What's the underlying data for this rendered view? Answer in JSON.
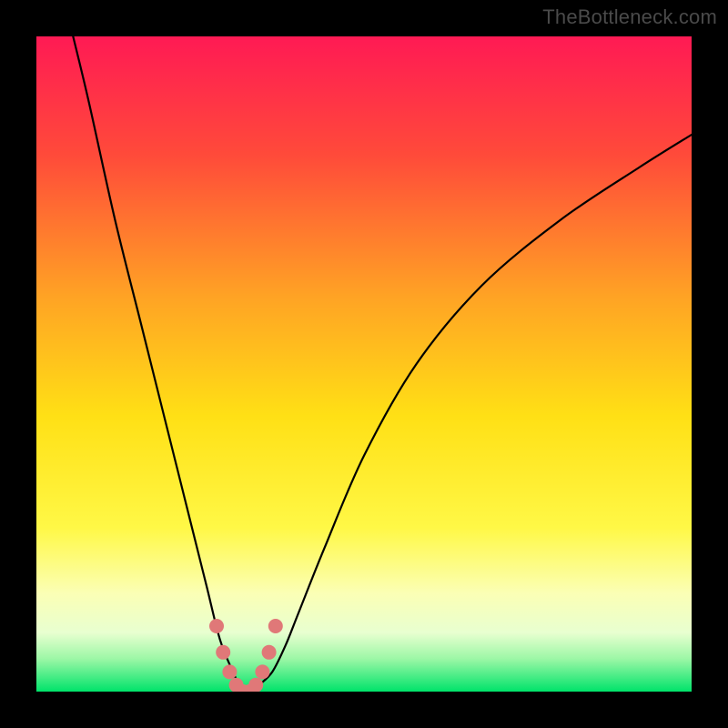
{
  "watermark": {
    "text": "TheBottleneck.com"
  },
  "chart_data": {
    "type": "line",
    "title": "",
    "xlabel": "",
    "ylabel": "",
    "xlim": [
      0,
      100
    ],
    "ylim": [
      0,
      100
    ],
    "background_gradient_stops": [
      {
        "pct": 0,
        "color": "#ff1a54"
      },
      {
        "pct": 18,
        "color": "#ff4a3a"
      },
      {
        "pct": 40,
        "color": "#ffa424"
      },
      {
        "pct": 58,
        "color": "#ffe015"
      },
      {
        "pct": 75,
        "color": "#fff846"
      },
      {
        "pct": 85,
        "color": "#fbffb5"
      },
      {
        "pct": 91,
        "color": "#e8ffd0"
      },
      {
        "pct": 95,
        "color": "#9cf7a6"
      },
      {
        "pct": 100,
        "color": "#00e36a"
      }
    ],
    "series": [
      {
        "name": "bottleneck-curve",
        "x": [
          5.6,
          8,
          12,
          16,
          20,
          24,
          26,
          28,
          30,
          31,
          32,
          33,
          34,
          36,
          38,
          40,
          44,
          50,
          58,
          68,
          80,
          92,
          100
        ],
        "y": [
          100,
          90,
          72,
          56,
          40,
          24,
          16,
          8,
          3,
          1,
          0,
          0,
          1,
          3,
          7,
          12,
          22,
          36,
          50,
          62,
          72,
          80,
          85
        ]
      }
    ],
    "trough_markers": {
      "name": "trough-dots",
      "x": [
        27.5,
        28.5,
        29.5,
        30.5,
        31.5,
        32.5,
        33.5,
        34.5,
        35.5,
        36.5
      ],
      "y": [
        10,
        6,
        3,
        1,
        0,
        0,
        1,
        3,
        6,
        10
      ]
    },
    "marker_style": {
      "radius_px": 8,
      "color": "#e07878"
    }
  }
}
